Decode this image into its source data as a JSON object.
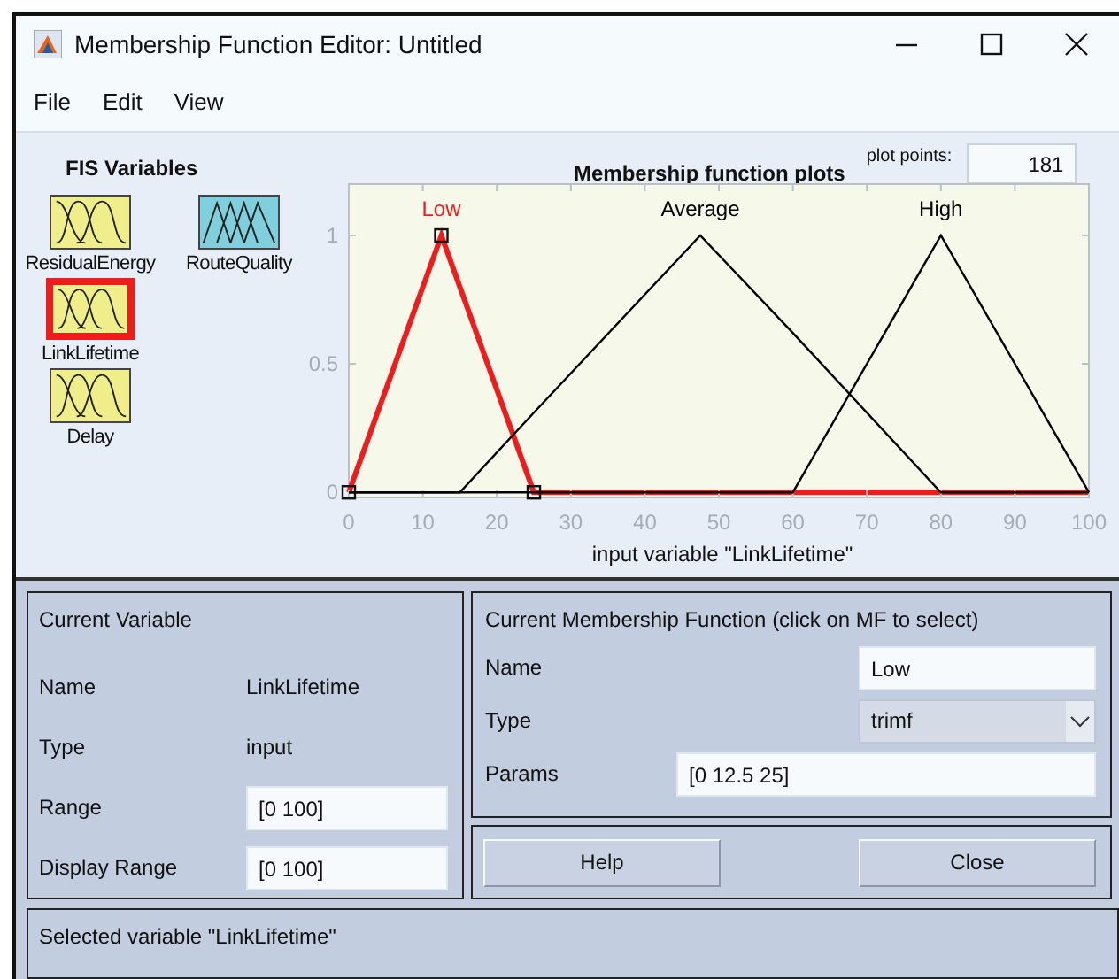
{
  "window": {
    "title": "Membership Function Editor: Untitled"
  },
  "menu": [
    "File",
    "Edit",
    "View"
  ],
  "fis_variables": {
    "title": "FIS Variables",
    "items": [
      {
        "name": "ResidualEnergy",
        "kind": "input",
        "selected": false
      },
      {
        "name": "RouteQuality",
        "kind": "output",
        "selected": false
      },
      {
        "name": "LinkLifetime",
        "kind": "input",
        "selected": true
      },
      {
        "name": "Delay",
        "kind": "input",
        "selected": false
      }
    ]
  },
  "plot": {
    "title": "Membership function plots",
    "plot_points_label": "plot points:",
    "plot_points": "181",
    "xlabel": "input variable \"LinkLifetime\"",
    "chart_data": {
      "type": "line",
      "x": [
        0,
        12.5,
        15,
        25,
        47.5,
        60,
        80,
        100
      ],
      "xlim": [
        0,
        100
      ],
      "ylim": [
        -0.02,
        1.2
      ],
      "xticks": [
        0,
        10,
        20,
        30,
        40,
        50,
        60,
        70,
        80,
        90,
        100
      ],
      "yticks": [
        0,
        {
          "value": 0.5,
          "label": "0.5"
        },
        1
      ],
      "series": [
        {
          "name": "Low",
          "color": "#ee1c1c",
          "values": [
            0,
            1,
            0.8,
            0,
            0,
            0,
            0,
            0
          ]
        },
        {
          "name": "Average",
          "color": "#000000",
          "values": [
            0,
            0,
            0,
            0.31,
            1,
            0.62,
            0,
            0
          ]
        },
        {
          "name": "High",
          "color": "#000000",
          "values": [
            0,
            0,
            0,
            0,
            0,
            0,
            1,
            0
          ]
        }
      ]
    },
    "membership_functions": [
      {
        "selected": true
      },
      {
        "selected": false
      },
      {
        "selected": false
      }
    ]
  },
  "current_variable": {
    "title": "Current Variable",
    "rows": [
      {
        "label": "Name",
        "kind": "text",
        "value": "LinkLifetime"
      },
      {
        "label": "Type",
        "kind": "text",
        "value": "input"
      },
      {
        "label": "Range",
        "kind": "field",
        "value": "[0 100]"
      },
      {
        "label": "Display Range",
        "kind": "field",
        "value": "[0 100]"
      }
    ]
  },
  "current_mf": {
    "title": "Current Membership Function (click on MF to select)",
    "name_label": "Name",
    "name": "Low",
    "type_label": "Type",
    "type": "trimf",
    "params_label": "Params",
    "params": "[0 12.5 25]"
  },
  "buttons": [
    "Help",
    "Close"
  ],
  "status": "Selected variable \"LinkLifetime\""
}
